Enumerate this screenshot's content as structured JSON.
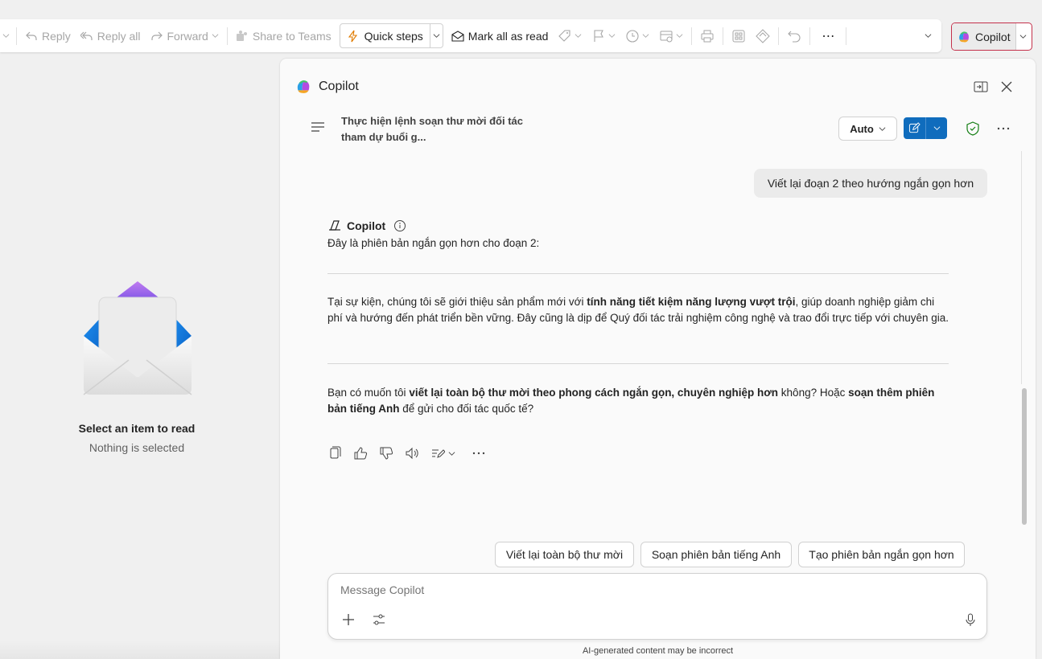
{
  "toolbar": {
    "reply": "Reply",
    "reply_all": "Reply all",
    "forward": "Forward",
    "share_to_teams": "Share to Teams",
    "quick_steps": "Quick steps",
    "mark_all_read": "Mark all as read",
    "copilot": "Copilot"
  },
  "reading_pane": {
    "title": "Select an item to read",
    "subtitle": "Nothing is selected"
  },
  "copilot": {
    "title": "Copilot",
    "conversation_title": "Thực hiện lệnh soạn thư mời đối tác tham dự buổi g...",
    "mode": "Auto",
    "user_message": "Viết lại đoạn 2 theo hướng ngắn gọn hơn",
    "response_author": "Copilot",
    "response_intro": "Đây là phiên bản ngắn gọn hơn cho đoạn 2:",
    "para1": {
      "a": "Tại sự kiện, chúng tôi sẽ giới thiệu sản phẩm mới với ",
      "b": "tính năng tiết kiệm năng lượng vượt trội",
      "c": ", giúp doanh nghiệp giảm chi phí và hướng đến phát triển bền vững. Đây cũng là dịp để Quý đối tác trải nghiệm công nghệ và trao đổi trực tiếp với chuyên gia."
    },
    "para2": {
      "a": "Bạn có muốn tôi ",
      "b": "viết lại toàn bộ thư mời theo phong cách ngắn gọn, chuyên nghiệp hơn",
      "c": " không? Hoặc ",
      "d": "soạn thêm phiên bản tiếng Anh",
      "e": " để gửi cho đối tác quốc tế?"
    },
    "suggestions": [
      "Viết lại toàn bộ thư mời",
      "Soạn phiên bản tiếng Anh",
      "Tạo phiên bản ngắn gọn hơn"
    ],
    "input_placeholder": "Message Copilot",
    "disclaimer": "AI-generated content may be incorrect"
  }
}
